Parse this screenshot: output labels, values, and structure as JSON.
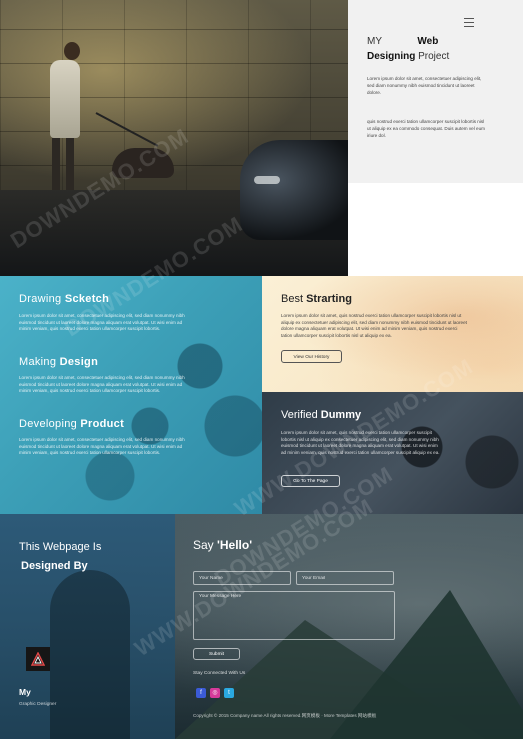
{
  "hero": {
    "menu_icon": "hamburger-menu-icon",
    "title_prefix": "MY",
    "title_web": "Web",
    "title_designing": "Designing",
    "title_project": "Project",
    "paragraph_1": "Lorem ipsum dolor sit amet, consectetuer adipiscing elit, sed diam nonummy nibh euismod tincidunt ut laoreet dolore.",
    "paragraph_2": "quis nostrud exerci tation ullamcorper suscipit lobortis nisl ut aliquip ex ea commodo consequat. Duis autem vel eum iriure dol."
  },
  "services": [
    {
      "title_light": "Drawing",
      "title_bold": "Scketch",
      "text": "Lorem ipsum dolor sit amet, consectetuer adipiscing elit, sed diam nonummy nibh euismod tincidunt ut laoreet dolore magna aliquam erat volutpat. Ut wisi enim ad minim veniam, quis nostrud exerci tation ullamcorper suscipit lobortis."
    },
    {
      "title_light": "Making",
      "title_bold": "Design",
      "text": "Lorem ipsum dolor sit amet, consectetuer adipiscing elit, sed diam nonummy nibh euismod tincidunt ut laoreet dolore magna aliquam erat volutpat. Ut wisi enim ad minim veniam, quis nostrud exerci tation ullamcorper suscipit lobortis."
    },
    {
      "title_light": "Developing",
      "title_bold": "Product",
      "text": "Lorem ipsum dolor sit amet, consectetuer adipiscing elit, sed diam nonummy nibh euismod tincidunt ut laoreet dolore magna aliquam erat volutpat. Ut wisi enim ad minim veniam, quis nostrud exerci tation ullamcorper suscipit lobortis."
    }
  ],
  "best": {
    "title_light": "Best",
    "title_bold": "Strarting",
    "text": "Lorem ipsum dolor sit amet, quis nostrud exerci tation ullamcorper suscipit lobortis nisl ut aliquip ex consectetuer adipiscing elit, sed diam nonummy nibh euismod tincidunt ut laoreet dolore magna aliquam erat volutpat. Ut wisi enim ad minim veniam, quis nostrud exerci tation ullamcorper suscipit lobortis nisl ut aliquip ex ea.",
    "button_label": "View Our History"
  },
  "verified": {
    "title_light": "Verified",
    "title_bold": "Dummy",
    "text": "Lorem ipsum dolor sit amet, quis nostrud exerci tation ullamcorper suscipit lobortis nisl ut aliquip ex consectetuer adipiscing elit, sed diam nonummy nibh euismod tincidunt ut laoreet dolore magna aliquam erat volutpat. Ut wisi enim ad minim veniam, quis nostrud exerci tation ullamcorper suscipit aliquip ex ea.",
    "button_label": "Go To The Page"
  },
  "about": {
    "line1": "This Webpage Is",
    "line2": "Designed By",
    "logo_icon": "triangle-logo-icon",
    "name": "My",
    "role": "Graphic Designer"
  },
  "contact": {
    "title_light": "Say",
    "title_bold": "'Hello'",
    "name_placeholder": "Your Name",
    "email_placeholder": "Your Email",
    "message_placeholder": "Your Message Here",
    "submit_label": "Submit",
    "stay_connected": "Stay Connected With Us",
    "social": [
      {
        "icon": "facebook-icon",
        "glyph": "f",
        "color": "#3b5bd6"
      },
      {
        "icon": "instagram-icon",
        "glyph": "◎",
        "color": "#d63a9a"
      },
      {
        "icon": "twitter-icon",
        "glyph": "t",
        "color": "#2aa8e0"
      }
    ],
    "copyright": "Copyright © 2015 Company name All rights reserved.网页模板 · More Templates 网站模板"
  },
  "watermarks": [
    "DOWNDEMO.COM",
    "DOWNDEMO.COM",
    "WWW.DOWNDEMO.COM",
    "DOWNDEMO.COM",
    "WWW.DOWNDEMO.COM"
  ]
}
